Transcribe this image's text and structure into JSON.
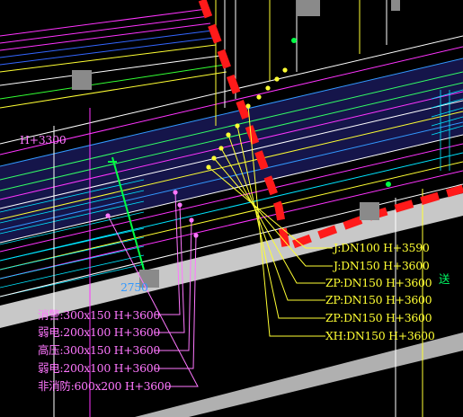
{
  "colors": {
    "background": "#000000",
    "road_band": "#c8c8c8",
    "duct_band": "#1a1a5a",
    "red_dash": "#ff1a1a",
    "yellow": "#ffff33",
    "pink": "#ff77ff",
    "green": "#00ff66",
    "blue": "#3399ff",
    "cyan": "#00e5ff"
  },
  "annotations": {
    "elevation_label": "H+3300",
    "mark_2750": "2750",
    "mark_right": "送",
    "pipes": [
      "J:DN100  H+3590",
      "J:DN150  H+3600",
      "ZP:DN150  H+3600",
      "ZP:DN150  H+3600",
      "ZP:DN150  H+3600",
      "XH:DN150  H+3600"
    ],
    "cable_trays": [
      "消警:300x150 H+3600",
      "弱电:200x100 H+3600",
      "高压:300x150 H+3600",
      "弱电:200x100 H+3600",
      "非消防:600x200 H+3600"
    ]
  },
  "icons": [
    "leader-dot-icon",
    "green-node-icon",
    "column-block-icon"
  ]
}
